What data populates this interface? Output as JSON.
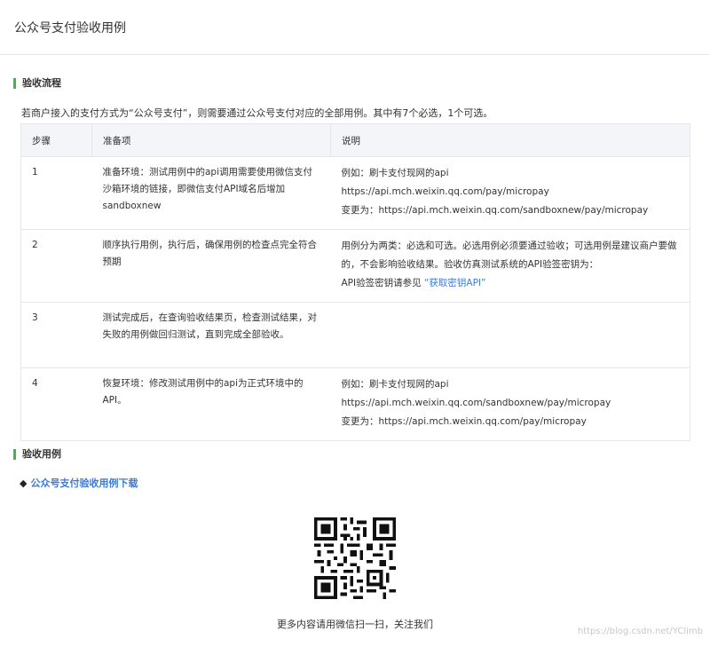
{
  "page": {
    "title": "公众号支付验收用例"
  },
  "section1": {
    "title": "验收流程",
    "intro": "若商户接入的支付方式为“公众号支付”，则需要通过公众号支付对应的全部用例。其中有7个必选，1个可选。"
  },
  "table": {
    "headers": [
      "步骤",
      "准备项",
      "说明"
    ],
    "rows": [
      {
        "step": "1",
        "prep": "准备环境：测试用例中的api调用需要使用微信支付沙箱环境的链接，即微信支付API域名后增加sandboxnew",
        "desc": [
          "例如：刷卡支付现网的api",
          "https://api.mch.weixin.qq.com/pay/micropay",
          "变更为：https://api.mch.weixin.qq.com/sandboxnew/pay/micropay"
        ]
      },
      {
        "step": "2",
        "prep": "顺序执行用例，执行后，确保用例的检查点完全符合预期",
        "desc_text": "用例分为两类：必选和可选。必选用例必须要通过验收；可选用例是建议商户要做的，不会影响验收结果。验收仿真测试系统的API验签密钥为：",
        "desc_link_prefix": "API验签密钥请参见 ",
        "desc_link": "“获取密钥API”"
      },
      {
        "step": "3",
        "prep": "测试完成后，在查询验收结果页，检查测试结果，对失败的用例做回归测试，直到完成全部验收。"
      },
      {
        "step": "4",
        "prep": "恢复环境：修改测试用例中的api为正式环境中的API。",
        "desc": [
          "例如：刷卡支付现网的api",
          "https://api.mch.weixin.qq.com/sandboxnew/pay/micropay",
          "变更为：https://api.mch.weixin.qq.com/pay/micropay"
        ]
      }
    ]
  },
  "section2": {
    "title": "验收用例",
    "bullet": "◆",
    "download_link": "公众号支付验收用例下载"
  },
  "footer": {
    "qr_caption": "更多内容请用微信扫一扫，关注我们",
    "watermark": "https://blog.csdn.net/YClimb"
  },
  "colors": {
    "accent_green": "#44b549",
    "link_blue": "#3c7ad7",
    "header_bg": "#f4f5f9",
    "border": "#e4e8eb"
  }
}
